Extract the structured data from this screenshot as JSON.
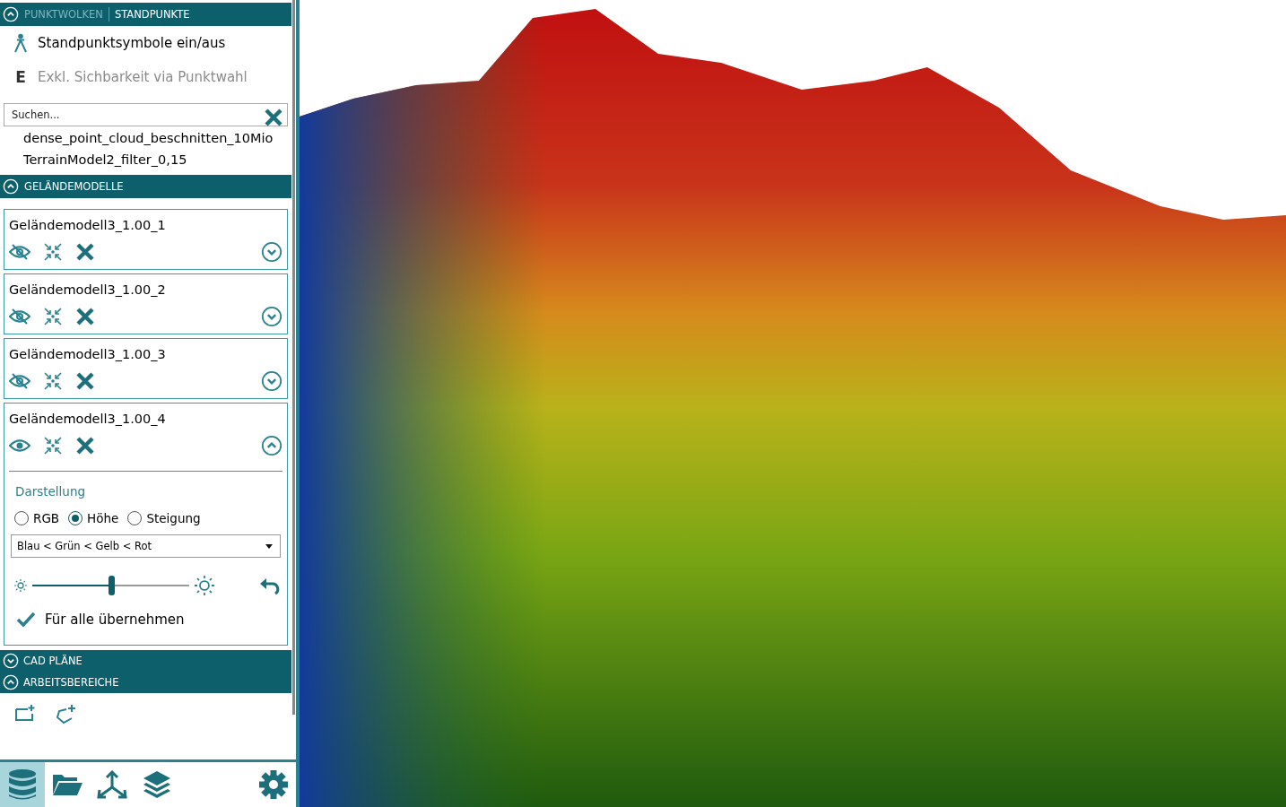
{
  "header_tabs": [
    {
      "label": "PUNKTWOLKEN",
      "selected": false
    },
    {
      "label": "STANDPUNKTE",
      "selected": true
    }
  ],
  "options": [
    {
      "kind": "tripod",
      "label": "Standpunktsymbole ein/aus",
      "disabled": false
    },
    {
      "kind": "letter",
      "icon_text": "E",
      "label": "Exkl. Sichbarkeit via Punktwahl",
      "disabled": true
    }
  ],
  "search": {
    "placeholder": "Suchen..."
  },
  "clouds": [
    "dense_point_cloud_beschnitten_10Mio",
    "TerrainModel2_filter_0,15"
  ],
  "terrain_section": {
    "title": "GELÄNDEMODELLE",
    "expanded": true
  },
  "models": [
    {
      "name": "Geländemodell3_1.00_1",
      "visible": false,
      "expanded": false
    },
    {
      "name": "Geländemodell3_1.00_2",
      "visible": false,
      "expanded": false
    },
    {
      "name": "Geländemodell3_1.00_3",
      "visible": false,
      "expanded": false
    },
    {
      "name": "Geländemodell3_1.00_4",
      "visible": true,
      "expanded": true
    }
  ],
  "display": {
    "title": "Darstellung",
    "modes": [
      {
        "label": "RGB",
        "selected": false
      },
      {
        "label": "Höhe",
        "selected": true
      },
      {
        "label": "Steigung",
        "selected": false
      }
    ],
    "palette": "Blau < Grün < Gelb < Rot",
    "level": 0.5,
    "apply_all": {
      "label": "Für alle übernehmen",
      "checked": true
    }
  },
  "sections": [
    {
      "title": "CAD PLÄNE",
      "expanded": false
    },
    {
      "title": "ARBEITSBEREICHE",
      "expanded": true
    }
  ],
  "bottom_tabs": [
    {
      "kind": "database",
      "selected": true
    },
    {
      "kind": "folder",
      "selected": false
    },
    {
      "kind": "axes",
      "selected": false
    },
    {
      "kind": "layers",
      "selected": false
    },
    {
      "kind": "settings",
      "selected": false
    }
  ]
}
